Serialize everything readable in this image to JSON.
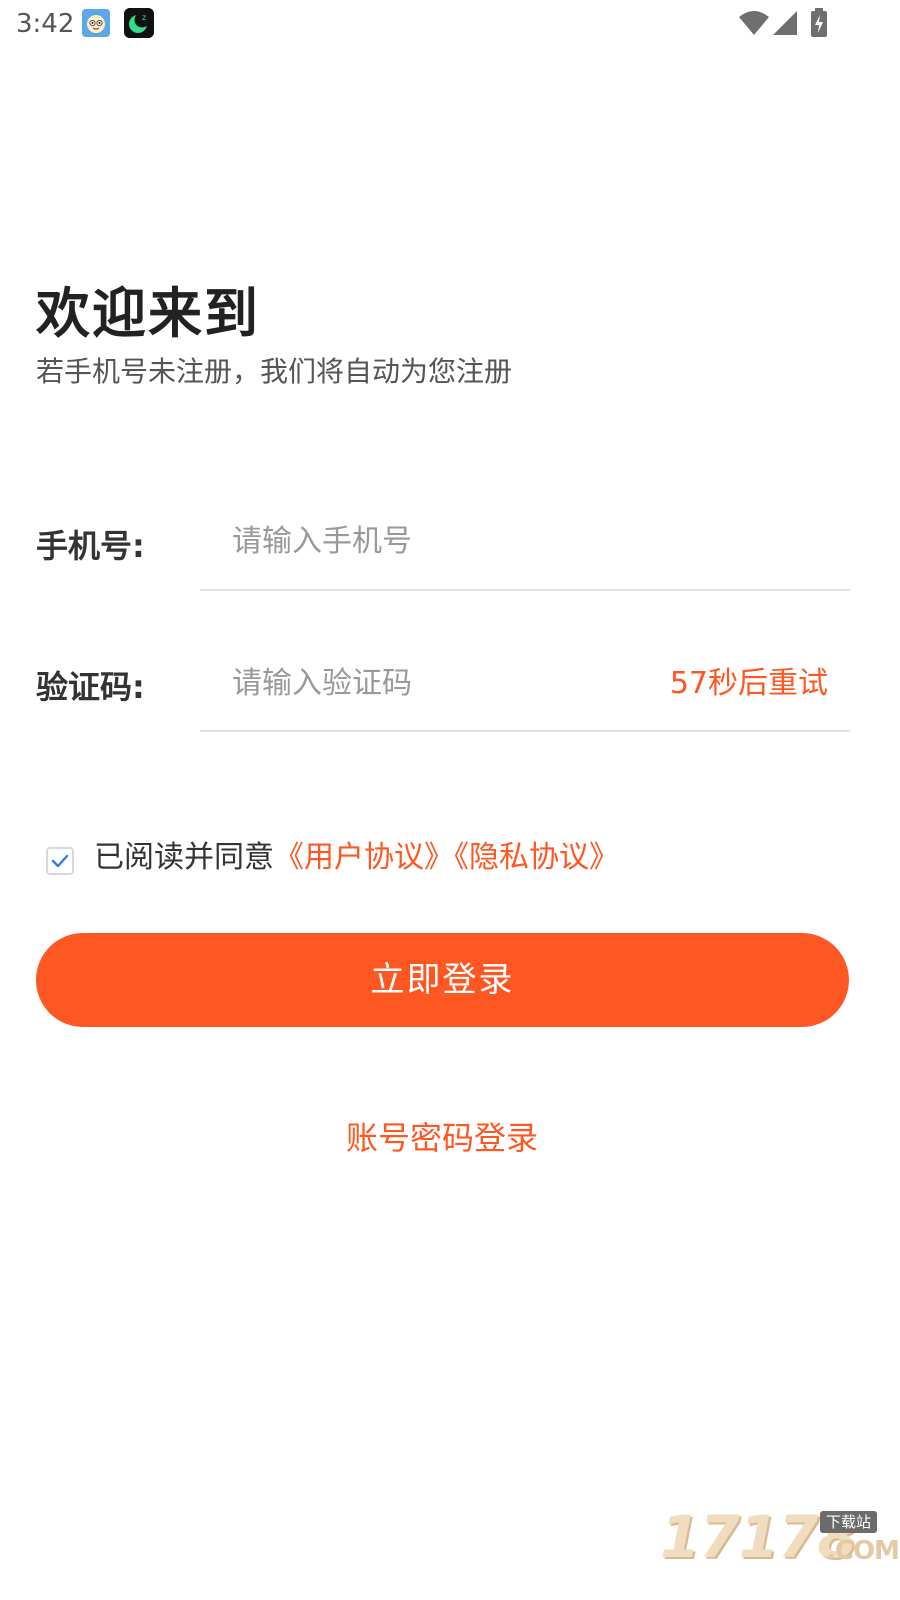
{
  "status_bar": {
    "time": "3:42",
    "icons": [
      "app-icon-face",
      "app-icon-moon",
      "wifi-icon",
      "signal-icon",
      "battery-charging-icon"
    ]
  },
  "header": {
    "title": "欢迎来到",
    "subtitle": "若手机号未注册，我们将自动为您注册"
  },
  "form": {
    "phone_label": "手机号:",
    "phone_placeholder": "请输入手机号",
    "phone_value": "",
    "code_label": "验证码:",
    "code_placeholder": "请输入验证码",
    "code_value": "",
    "resend_countdown": "57秒后重试"
  },
  "agreement": {
    "checked": true,
    "prefix": "已阅读并同意",
    "user_agreement": "《用户协议》",
    "privacy_agreement": "《隐私协议》"
  },
  "actions": {
    "login_label": "立即登录",
    "password_login_label": "账号密码登录"
  },
  "watermark": {
    "number": "17178",
    "badge": "下载站",
    "domain": ".COM"
  },
  "colors": {
    "accent": "#ff5722",
    "title": "#222222",
    "body_text": "#333333",
    "placeholder": "#999999",
    "divider": "#e2e2e2",
    "checkbox_tick": "#2f7de1"
  }
}
